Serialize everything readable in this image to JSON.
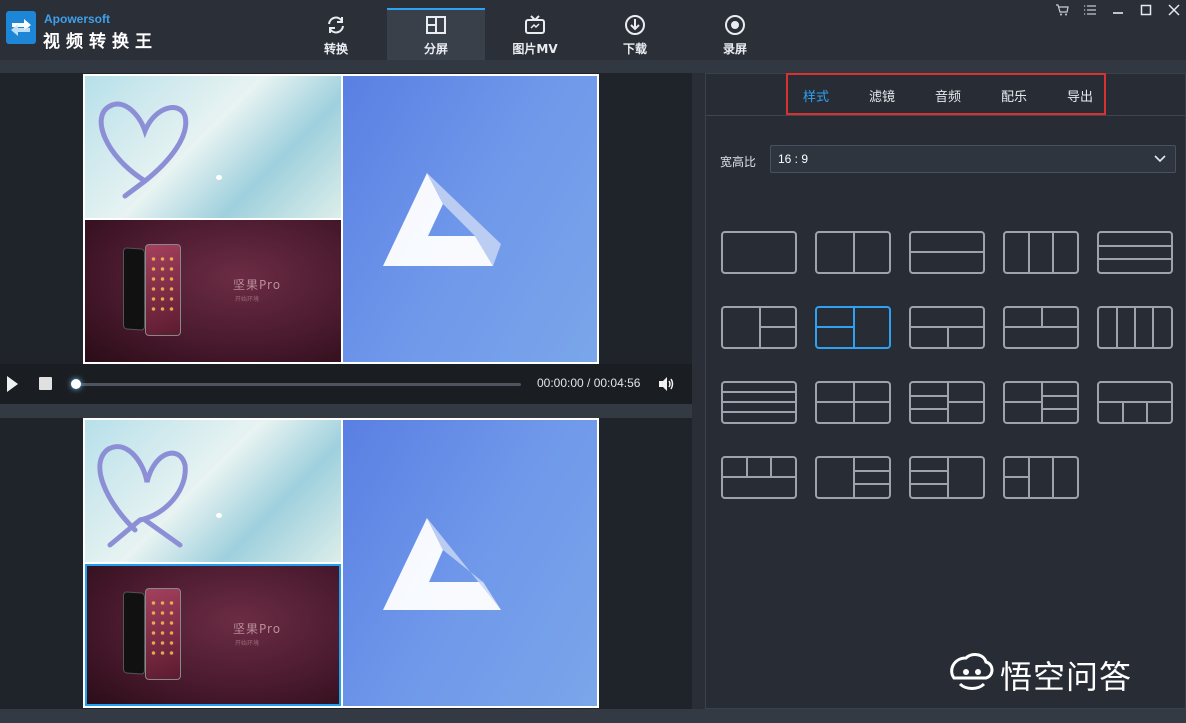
{
  "app": {
    "brand_en": "Apowersoft",
    "brand_cn": "视频转换王"
  },
  "nav": [
    {
      "label": "转换",
      "icon": "refresh-icon",
      "active": false
    },
    {
      "label": "分屏",
      "icon": "split-screen-icon",
      "active": true
    },
    {
      "label": "图片MV",
      "icon": "tv-icon",
      "active": false
    },
    {
      "label": "下载",
      "icon": "download-icon",
      "active": false
    },
    {
      "label": "录屏",
      "icon": "record-icon",
      "active": false
    }
  ],
  "window_controls": [
    "cart-icon",
    "menu-icon",
    "minimize-icon",
    "maximize-icon",
    "close-icon"
  ],
  "preview": {
    "promo_text": "坚果Pro",
    "promo_sub": "开始环境"
  },
  "player": {
    "time": "00:00:00 / 00:04:56",
    "progress": 0
  },
  "panel": {
    "tabs": [
      {
        "label": "样式",
        "active": true
      },
      {
        "label": "滤镜",
        "active": false
      },
      {
        "label": "音频",
        "active": false
      },
      {
        "label": "配乐",
        "active": false
      },
      {
        "label": "导出",
        "active": false
      }
    ],
    "ratio_label": "宽高比",
    "ratio_value": "16 : 9",
    "layouts_count": 19,
    "selected_layout_index": 6
  },
  "colors": {
    "accent": "#2ea1f2",
    "highlight_box": "#d9312f",
    "background": "#2a2f37"
  },
  "watermark": {
    "text": "悟空问答",
    "icon": "wukong-logo-icon"
  }
}
